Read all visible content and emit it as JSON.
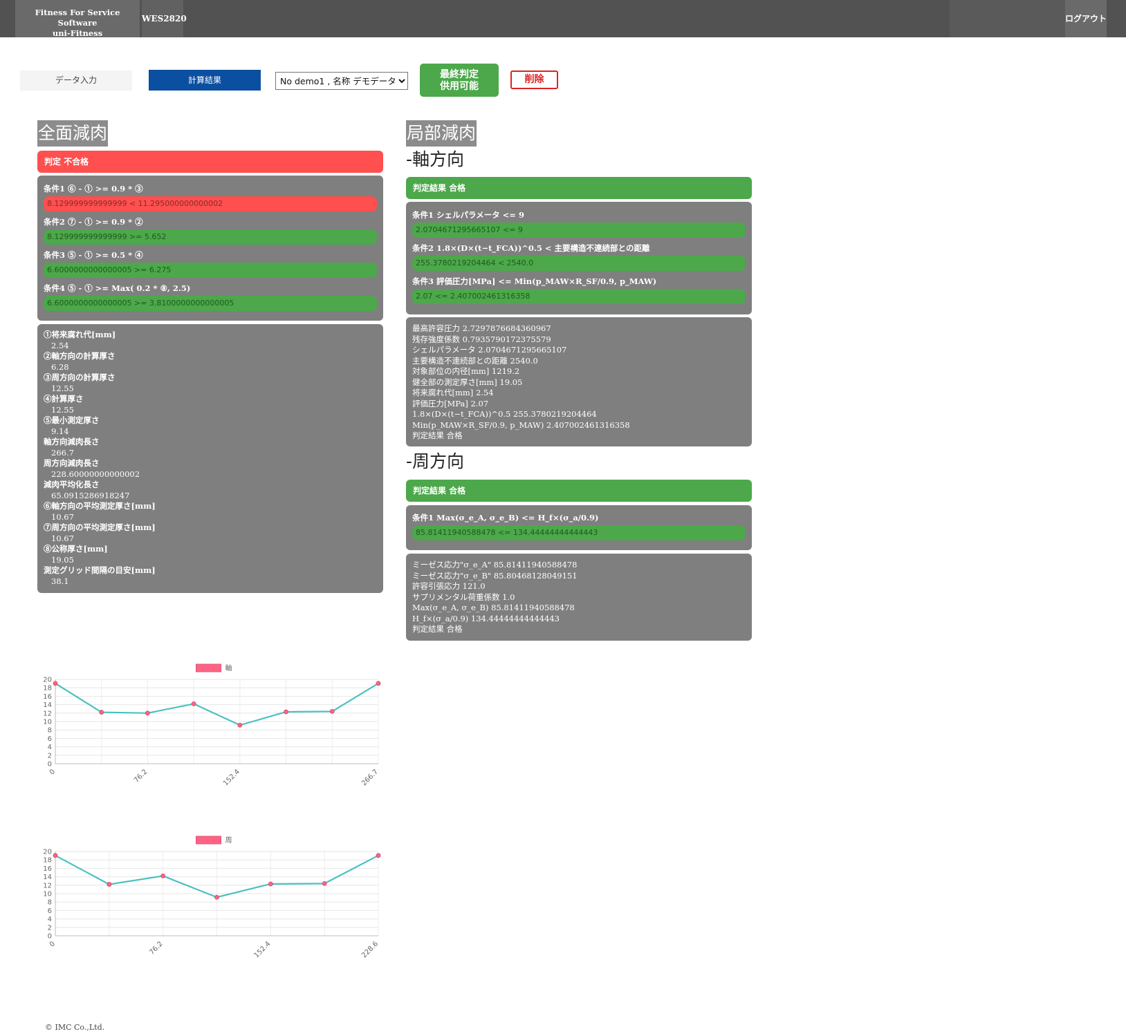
{
  "header": {
    "brand_line1": "Fitness For Service Software",
    "brand_line2": "uni-Fitness",
    "module": "WES2820",
    "logout_label": "ログアウト"
  },
  "toolbar": {
    "data_input_tab": "データ入力",
    "result_tab": "計算結果",
    "record_select": "No demo1 , 名称 デモデータ1",
    "final_line1": "最終判定",
    "final_line2": "供用可能",
    "delete_label": "削除"
  },
  "colors": {
    "fail": "#ff4f4f",
    "pass": "#4ca84a",
    "active_tab": "#0b4fa0",
    "panel": "#7f7f7f",
    "line": "#4bc0c0",
    "point": "#ff6384"
  },
  "general": {
    "title": "全面減肉",
    "verdict": "判定 不合格",
    "conditions": [
      {
        "label": "条件1 ⑥ - ① >= 0.9 * ③",
        "value": "8.129999999999999 < 11.295000000000002",
        "pass": false
      },
      {
        "label": "条件2 ⑦ - ① >= 0.9 * ②",
        "value": "8.129999999999999 >= 5.652",
        "pass": true
      },
      {
        "label": "条件3 ⑤ - ① >= 0.5 * ④",
        "value": "6.6000000000000005 >= 6.275",
        "pass": true
      },
      {
        "label": "条件4 ⑤ - ① >= Max( 0.2 * ⑧, 2.5)",
        "value": "6.6000000000000005 >= 3.8100000000000005",
        "pass": true
      }
    ],
    "params": [
      {
        "label": "①将来腐れ代[mm]",
        "value": "2.54"
      },
      {
        "label": "②軸方向の計算厚さ",
        "value": "6.28"
      },
      {
        "label": "③周方向の計算厚さ",
        "value": "12.55"
      },
      {
        "label": "④計算厚さ",
        "value": "12.55"
      },
      {
        "label": "⑤最小測定厚さ",
        "value": "9.14"
      },
      {
        "label": "軸方向減肉長さ",
        "value": "266.7"
      },
      {
        "label": "周方向減肉長さ",
        "value": "228.60000000000002"
      },
      {
        "label": "減肉平均化長さ",
        "value": "65.0915286918247"
      },
      {
        "label": "⑥軸方向の平均測定厚さ[mm]",
        "value": "10.67"
      },
      {
        "label": "⑦周方向の平均測定厚さ[mm]",
        "value": "10.67"
      },
      {
        "label": "⑧公称厚さ[mm]",
        "value": "19.05"
      },
      {
        "label": "測定グリッド間隔の目安[mm]",
        "value": "38.1"
      }
    ]
  },
  "local": {
    "title": "局部減肉",
    "axial": {
      "title": "-軸方向",
      "verdict": "判定結果 合格",
      "conditions": [
        {
          "label": "条件1 シェルパラメータ <= 9",
          "value": "2.0704671295665107 <= 9",
          "pass": true
        },
        {
          "label": "条件2 1.8×(D×(t−t_FCA))^0.5 < 主要構造不連続部との距離",
          "value": "255.3780219204464 < 2540.0",
          "pass": true
        },
        {
          "label": "条件3 評価圧力[MPa] <= Min(p_MAW×R_SF/0.9, p_MAW)",
          "value": "2.07 <= 2.407002461316358",
          "pass": true
        }
      ],
      "info": [
        "最高許容圧力 2.7297876684360967",
        "残存強度係数 0.7935790172375579",
        "シェルパラメータ 2.0704671295665107",
        "主要構造不連続部との距離 2540.0",
        "対象部位の内径[mm] 1219.2",
        "健全部の測定厚さ[mm] 19.05",
        "将来腐れ代[mm] 2.54",
        "評価圧力[MPa] 2.07",
        "1.8×(D×(t−t_FCA))^0.5 255.3780219204464",
        "Min(p_MAW×R_SF/0.9, p_MAW) 2.407002461316358",
        "判定結果 合格"
      ]
    },
    "circ": {
      "title": "-周方向",
      "verdict": "判定結果 合格",
      "conditions": [
        {
          "label": "条件1 Max(σ_e_A, σ_e_B) <= H_f×(σ_a/0.9)",
          "value": "85.81411940588478 <= 134.44444444444443",
          "pass": true
        }
      ],
      "info": [
        "ミーゼス応力\"σ_e_A\" 85.81411940588478",
        "ミーゼス応力\"σ_e_B\" 85.80468128049151",
        "許容引張応力 121.0",
        "サプリメンタル荷重係数 1.0",
        "Max(σ_e_A, σ_e_B) 85.81411940588478",
        "H_f×(σ_a/0.9) 134.44444444444443",
        "判定結果 合格"
      ]
    }
  },
  "chart_data": [
    {
      "type": "line",
      "series": [
        {
          "name": "軸",
          "values": [
            19.05,
            12.2,
            12.0,
            14.2,
            9.14,
            12.3,
            12.4,
            19.05
          ]
        }
      ],
      "x": [
        0,
        38.1,
        76.2,
        114.3,
        152.4,
        190.5,
        228.6,
        266.7
      ],
      "tick_labels": [
        "0",
        "76.2",
        "152.4",
        "266.7"
      ],
      "ylim": [
        0,
        20
      ],
      "yticks": [
        0,
        2,
        4,
        6,
        8,
        10,
        12,
        14,
        16,
        18,
        20
      ],
      "legend": "top-center",
      "grid": true
    },
    {
      "type": "line",
      "series": [
        {
          "name": "周",
          "values": [
            19.05,
            12.2,
            14.2,
            9.14,
            12.3,
            12.4,
            19.05
          ]
        }
      ],
      "x": [
        0,
        38.1,
        76.2,
        114.3,
        152.4,
        190.5,
        228.6
      ],
      "tick_labels": [
        "0",
        "76.2",
        "152.4",
        "228.6"
      ],
      "ylim": [
        0,
        20
      ],
      "yticks": [
        0,
        2,
        4,
        6,
        8,
        10,
        12,
        14,
        16,
        18,
        20
      ],
      "legend": "top-center",
      "grid": true
    }
  ],
  "footer": "© IMC Co.,Ltd."
}
